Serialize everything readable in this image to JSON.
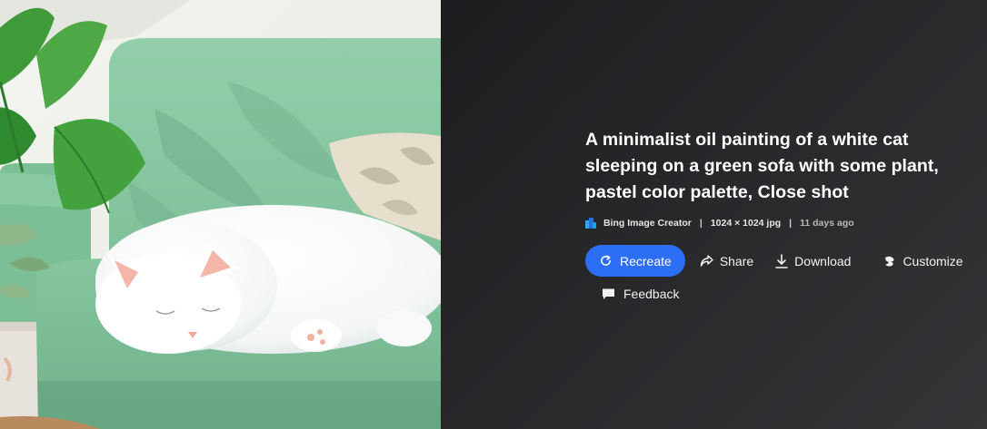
{
  "image": {
    "description_icon": "generated-image",
    "colors": {
      "sofa": "#8fcba5",
      "sofa_dark": "#6fb48b",
      "wall": "#eef1ea",
      "cat": "#ffffff",
      "leaf": "#3f9a3a",
      "pillow": "#e3ddc9"
    }
  },
  "details": {
    "title": "A minimalist oil painting of a white cat sleeping on a green sofa with some plant, pastel color palette, Close shot",
    "meta": {
      "creator": "Bing Image Creator",
      "separator": "|",
      "dimensions": "1024 × 1024 jpg",
      "age": "11 days ago",
      "creator_icon": "bing-image-creator-icon"
    },
    "actions": {
      "recreate": {
        "label": "Recreate",
        "icon": "refresh-icon"
      },
      "share": {
        "label": "Share",
        "icon": "share-icon"
      },
      "download": {
        "label": "Download",
        "icon": "download-icon"
      },
      "customize": {
        "label": "Customize",
        "icon": "customize-icon"
      },
      "feedback": {
        "label": "Feedback",
        "icon": "feedback-icon"
      }
    },
    "colors": {
      "primary_button": "#2d6ef7",
      "panel_bg": "#232225",
      "title_text": "#ffffff"
    }
  }
}
